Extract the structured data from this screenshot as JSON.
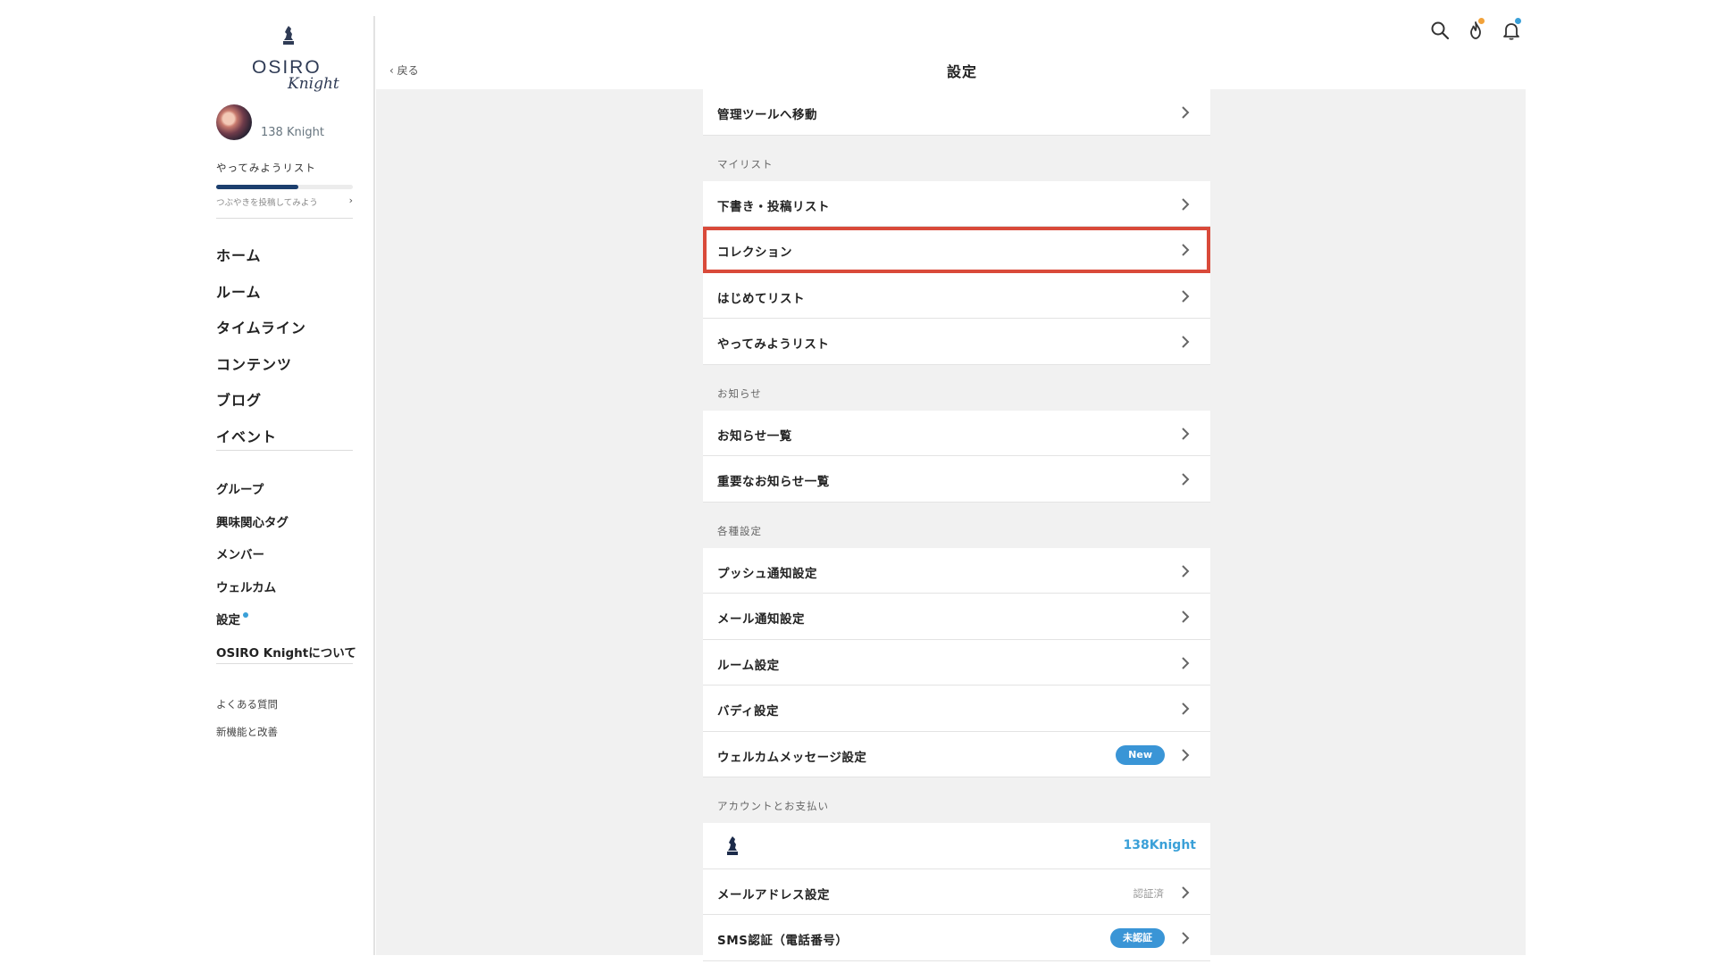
{
  "sidebar": {
    "logo_word": "OSIRO",
    "logo_script": "Knight",
    "profile_name": "138 Knight",
    "try_list_label": "やってみようリスト",
    "try_list_progress": 0.6,
    "try_list_hint": "つぶやきを投稿してみよう",
    "nav_main": [
      "ホーム",
      "ルーム",
      "タイムライン",
      "コンテンツ",
      "ブログ",
      "イベント"
    ],
    "nav_sub": [
      "グループ",
      "興味関心タグ",
      "メンバー",
      "ウェルカム",
      "設定",
      "OSIRO Knightについて"
    ],
    "nav_footer": [
      "よくある質問",
      "新機能と改善"
    ]
  },
  "header": {
    "back_label": "戻る",
    "title": "設定",
    "icons": [
      "search-icon",
      "flame-icon",
      "bell-icon"
    ],
    "flame_badge_color": "#f2a23a",
    "bell_badge_color": "#3aa0d8"
  },
  "settings": {
    "admin_row": "管理ツールへ移動",
    "mylist_header": "マイリスト",
    "mylist": [
      "下書き・投稿リスト",
      "コレクション",
      "はじめてリスト",
      "やってみようリスト"
    ],
    "notice_header": "お知らせ",
    "notice": [
      "お知らせ一覧",
      "重要なお知らせ一覧"
    ],
    "misc_header": "各種設定",
    "misc": [
      "プッシュ通知設定",
      "メール通知設定",
      "ルーム設定",
      "バディ設定",
      "ウェルカムメッセージ設定"
    ],
    "new_badge": "New",
    "account_header": "アカウントとお支払い",
    "account_name": "138Knight",
    "email_row": "メールアドレス設定",
    "email_status": "認証済",
    "sms_row": "SMS認証（電話番号）",
    "sms_status": "未認証"
  },
  "colors": {
    "accent": "#3aa0d8",
    "highlight": "#d94a3a",
    "navy": "#1c3f6e"
  }
}
